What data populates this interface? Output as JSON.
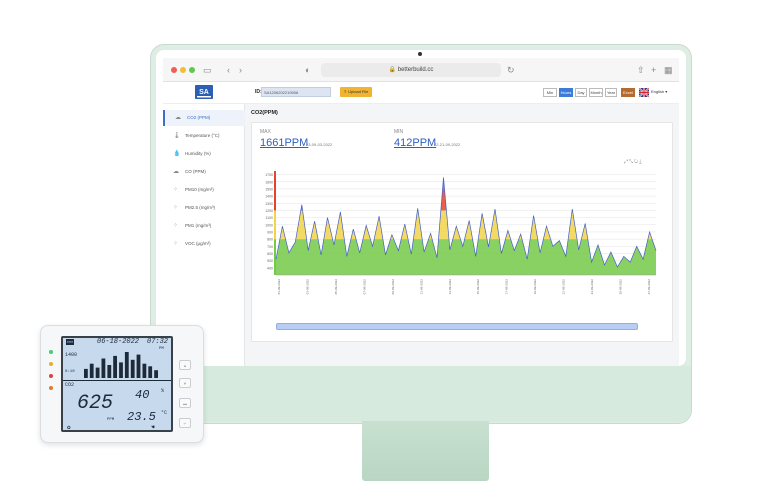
{
  "browser": {
    "url": "betterbuild.cc",
    "lock_icon": "lock-icon"
  },
  "header": {
    "id_label": "ID:",
    "id_value": "SA1206202219006",
    "upload_label": "Upload File",
    "ranges": [
      "Min",
      "Hours",
      "Day",
      "Month",
      "Year"
    ],
    "active_range": "Hours",
    "excel_label": "Excel",
    "language": "English"
  },
  "sidebar": {
    "items": [
      {
        "label": "CO2 (PPM)",
        "icon": "co2-icon",
        "active": true
      },
      {
        "label": "Temperature (°C)",
        "icon": "thermometer-icon",
        "active": false
      },
      {
        "label": "Humidity (%)",
        "icon": "humidity-icon",
        "active": false
      },
      {
        "label": "CO (PPM)",
        "icon": "co-icon",
        "active": false
      },
      {
        "label": "PM10 (mg/m³)",
        "icon": "pm10-icon",
        "active": false
      },
      {
        "label": "PM2.5 (mg/m³)",
        "icon": "pm25-icon",
        "active": false
      },
      {
        "label": "PM1 (mg/m³)",
        "icon": "pm1-icon",
        "active": false
      },
      {
        "label": "VOC (μg/m³)",
        "icon": "voc-icon",
        "active": false
      }
    ]
  },
  "main": {
    "title": "CO2(PPM)",
    "max_label": "MAX",
    "max_value": "1661PPM",
    "max_date": "23-09-03-2022",
    "min_label": "MIN",
    "min_value": "412PPM",
    "min_date": "22-21-09-2022"
  },
  "chart_data": {
    "type": "area",
    "title": "",
    "xlabel": "",
    "ylabel": "",
    "ylim": [
      300,
      1750
    ],
    "y_ticks": [
      400,
      500,
      600,
      700,
      800,
      900,
      1000,
      1100,
      1200,
      1300,
      1400,
      1500,
      1600,
      1700
    ],
    "x": [
      "01-09-2022",
      "03-09-2022",
      "05-09-2022",
      "07-09-2022",
      "09-09-2022",
      "11-09-2022",
      "13-09-2022",
      "15-09-2022",
      "17-09-2022",
      "19-09-2022",
      "21-09-2022",
      "23-09-2022",
      "25-09-2022",
      "27-09-2022"
    ],
    "series": [
      {
        "values": [
          520,
          980,
          610,
          760,
          1280,
          640,
          1050,
          580,
          1100,
          720,
          1180,
          560,
          940,
          610,
          990,
          700,
          1120,
          580,
          860,
          640,
          1010,
          590,
          1230,
          620,
          880,
          540,
          1661,
          650,
          980,
          700,
          1060,
          560,
          1160,
          690,
          1220,
          600,
          920,
          640,
          870,
          520,
          1130,
          610,
          980,
          700,
          780,
          560,
          1220,
          650,
          1020,
          480,
          720,
          440,
          620,
          412,
          560,
          480,
          700,
          520,
          900,
          640
        ]
      }
    ],
    "grid": true,
    "band_colors": {
      "good": "#74c947",
      "moderate": "#f1d44a",
      "poor": "#e5432f"
    },
    "line_color": "#4460c8"
  },
  "device": {
    "date": "06-18-2022",
    "time": "07:32",
    "status": "PM",
    "range": "1400",
    "axis_low": "0:10",
    "unit_label": "CO2",
    "co2": "625",
    "co2_unit": "PPM",
    "humidity": "40",
    "humidity_unit": "%",
    "temperature": "23.5",
    "temperature_unit": "°C",
    "bars": [
      0.35,
      0.55,
      0.4,
      0.75,
      0.5,
      0.85,
      0.6,
      1.0,
      0.7,
      0.9,
      0.55,
      0.45,
      0.3
    ]
  }
}
